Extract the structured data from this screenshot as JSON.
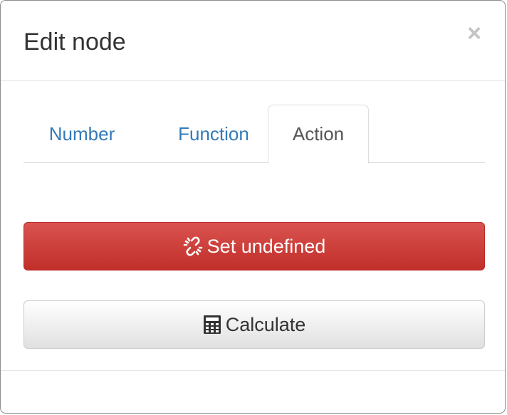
{
  "dialog": {
    "title": "Edit node",
    "close_symbol": "×"
  },
  "tabs": [
    {
      "label": "Number",
      "active": false
    },
    {
      "label": "Function",
      "active": false
    },
    {
      "label": "Action",
      "active": true
    }
  ],
  "actions": {
    "set_undefined": {
      "label": "Set undefined",
      "icon": "unlink-icon",
      "color": "#d9534f"
    },
    "calculate": {
      "label": "Calculate",
      "icon": "calculator-icon"
    }
  },
  "colors": {
    "link": "#337ab7",
    "danger": "#d9534f",
    "text": "#333333"
  }
}
